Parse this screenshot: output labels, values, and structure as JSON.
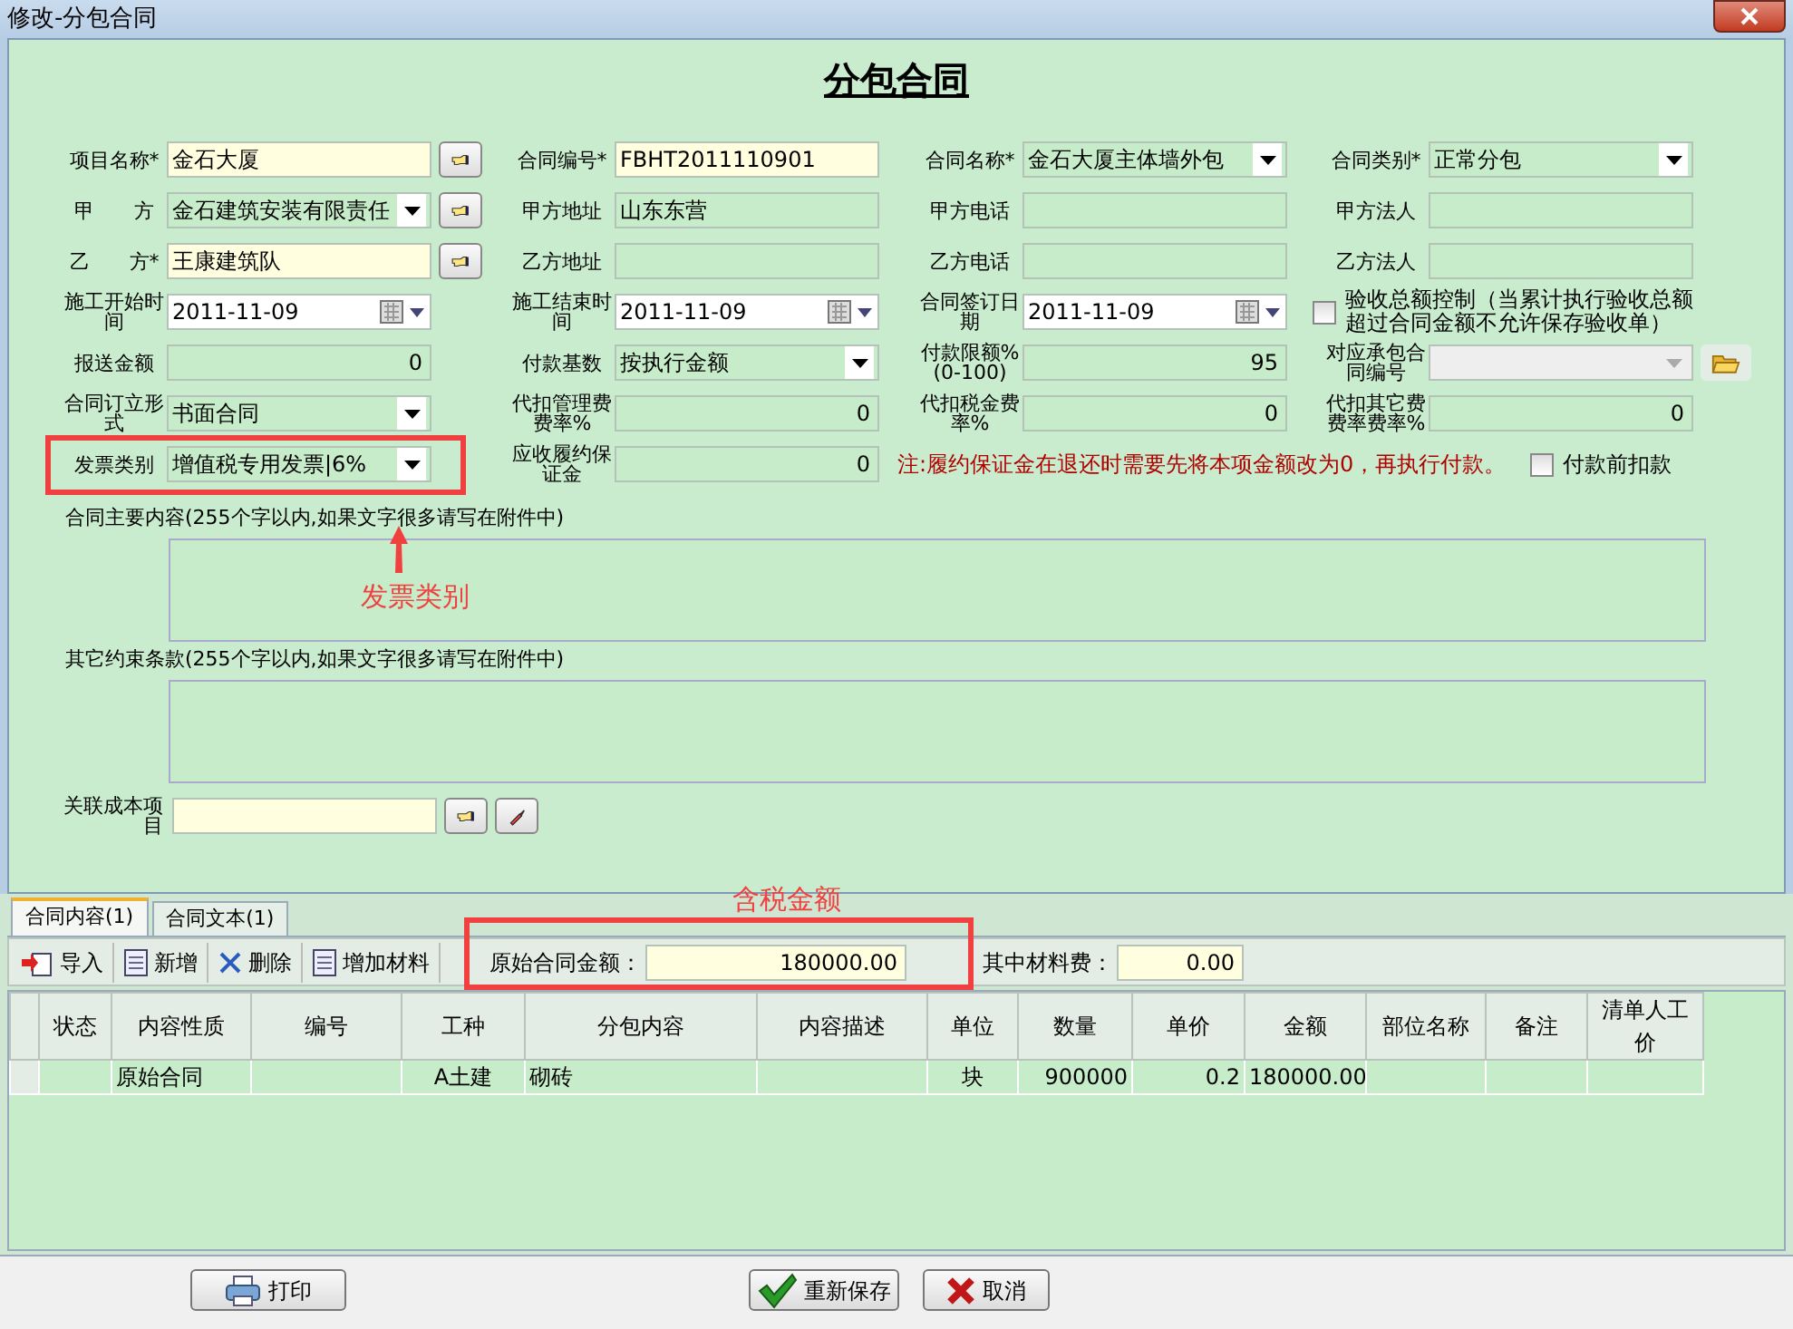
{
  "window": {
    "title": "修改-分包合同"
  },
  "heading": "分包合同",
  "form_rows": [
    [
      {
        "kind": "text",
        "label": "项目名称*",
        "value": "金石大厦",
        "highlighted": true,
        "lookup": true
      },
      {
        "kind": "text",
        "label": "合同编号*",
        "value": "FBHT2011110901",
        "highlighted": true
      },
      {
        "kind": "combo",
        "label": "合同名称*",
        "value": "金石大厦主体墙外包"
      },
      {
        "kind": "combo",
        "label": "合同类别*",
        "value": "正常分包"
      }
    ],
    [
      {
        "kind": "combo",
        "label": "甲　　方",
        "value": "金石建筑安装有限责任",
        "lookup": true
      },
      {
        "kind": "text",
        "label": "甲方地址",
        "value": "山东东营",
        "highlighted": false
      },
      {
        "kind": "text",
        "label": "甲方电话",
        "highlighted": false
      },
      {
        "kind": "text",
        "label": "甲方法人",
        "highlighted": false
      }
    ],
    [
      {
        "kind": "text",
        "label": "乙　　方*",
        "value": "王康建筑队",
        "highlighted": true,
        "lookup": true
      },
      {
        "kind": "text",
        "label": "乙方地址",
        "highlighted": false
      },
      {
        "kind": "text",
        "label": "乙方电话",
        "highlighted": false
      },
      {
        "kind": "text",
        "label": "乙方法人",
        "highlighted": false
      }
    ],
    [
      {
        "kind": "date",
        "label": "施工开始时间",
        "value": "2011-11-09"
      },
      {
        "kind": "date",
        "label": "施工结束时间",
        "value": "2011-11-09"
      },
      {
        "kind": "date",
        "label": "合同签订日期",
        "value": "2011-11-09"
      },
      {
        "kind": "checkbox",
        "label": "验收总额控制（当累计执行验收总额超过合同金额不允许保存验收单）",
        "checked": false
      }
    ],
    [
      {
        "kind": "number",
        "label": "报送金额",
        "value": "0"
      },
      {
        "kind": "combo",
        "label": "付款基数",
        "value": "按执行金额"
      },
      {
        "kind": "number",
        "label": "付款限额%(0-100)",
        "value": "95"
      },
      {
        "kind": "disabled_combo",
        "label": "对应承包合同编号"
      }
    ],
    [
      {
        "kind": "combo",
        "label": "合同订立形式",
        "value": "书面合同"
      },
      {
        "kind": "number",
        "label": "代扣管理费费率%",
        "value": "0"
      },
      {
        "kind": "number",
        "label": "代扣税金费率%",
        "value": "0"
      },
      {
        "kind": "number",
        "label": "代扣其它费费率费率%",
        "value": "0"
      }
    ],
    [
      {
        "kind": "combo",
        "label": "发票类别",
        "value": "增值税专用发票|6%"
      },
      {
        "kind": "number",
        "label": "应收履约保证金",
        "value": "0"
      },
      {
        "kind": "note",
        "label": "注:履约保证金在退还时需要先将本项金额改为0，再执行付款。"
      },
      {
        "kind": "checkbox",
        "label": "付款前扣款",
        "checked": false
      }
    ]
  ],
  "text_areas": [
    {
      "label": "合同主要内容(255个字以内,如果文字很多请写在附件中)"
    },
    {
      "label": "其它约束条款(255个字以内,如果文字很多请写在附件中)"
    }
  ],
  "cost_item": {
    "label": "关联成本项目"
  },
  "tabs": [
    {
      "label": "合同内容(1)",
      "selected": true
    },
    {
      "label": "合同文本(1)",
      "selected": false
    }
  ],
  "toolbar": [
    {
      "kind": "import",
      "label": "导入"
    },
    {
      "kind": "document",
      "label": "新增"
    },
    {
      "kind": "delete",
      "label": "删除"
    },
    {
      "kind": "document",
      "label": "增加材料"
    }
  ],
  "amounts": [
    {
      "label": "原始合同金额：",
      "value": "180000.00"
    },
    {
      "label": "其中材料费：",
      "value": "0.00"
    }
  ],
  "table": {
    "columns": [
      "状态",
      "内容性质",
      "编号",
      "工种",
      "分包内容",
      "内容描述",
      "单位",
      "数量",
      "单价",
      "金额",
      "部位名称",
      "备注",
      "清单人工价"
    ],
    "rows": [
      [
        "",
        "原始合同",
        "",
        "A土建",
        "砌砖",
        "",
        "块",
        "900000",
        "0.2",
        "180000.00",
        "",
        "",
        ""
      ]
    ]
  },
  "buttons": [
    {
      "kind": "print",
      "label": "打印"
    },
    {
      "kind": "save",
      "label": "重新保存"
    },
    {
      "kind": "cancel",
      "label": "取消"
    }
  ],
  "annotations": [
    {
      "text": "发票类别"
    },
    {
      "text": "含税金额"
    }
  ]
}
